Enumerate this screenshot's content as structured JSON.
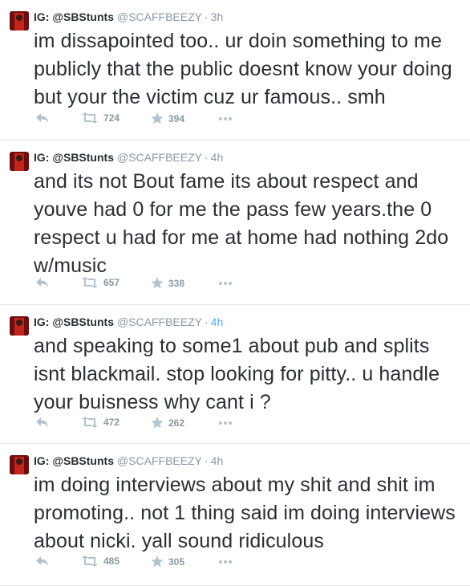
{
  "colors": {
    "text": "#292f33",
    "meta": "#8899a6",
    "divider": "#e1e8ed",
    "action_icons": "#b4c2cc",
    "time_highlight": "#55acee"
  },
  "tweets": [
    {
      "fullname": "IG: @SBStunts",
      "username": "@SCAFFBEEZY",
      "separator": "·",
      "time": "3h",
      "text": "im dissapointed too.. ur doin something to me publicly that the public doesnt know your doing but your the victim cuz ur famous.. smh",
      "retweets": "724",
      "favorites": "394"
    },
    {
      "fullname": "IG: @SBStunts",
      "username": "@SCAFFBEEZY",
      "separator": "·",
      "time": "4h",
      "text": "and its not Bout fame its about respect and youve had 0 for me the pass few years.the 0 respect u had for me at home had nothing 2do w/music",
      "retweets": "657",
      "favorites": "338"
    },
    {
      "fullname": "IG: @SBStunts",
      "username": "@SCAFFBEEZY",
      "separator": "·",
      "time": "4h",
      "text": "and speaking to some1 about pub and splits isnt blackmail. stop looking for pitty.. u handle your buisness why cant i ?",
      "retweets": "472",
      "favorites": "262"
    },
    {
      "fullname": "IG: @SBStunts",
      "username": "@SCAFFBEEZY",
      "separator": "·",
      "time": "4h",
      "text": "im doing interviews about my shit and shit im promoting.. not 1 thing said im doing interviews about nicki. yall sound ridiculous",
      "retweets": "485",
      "favorites": "305"
    }
  ]
}
